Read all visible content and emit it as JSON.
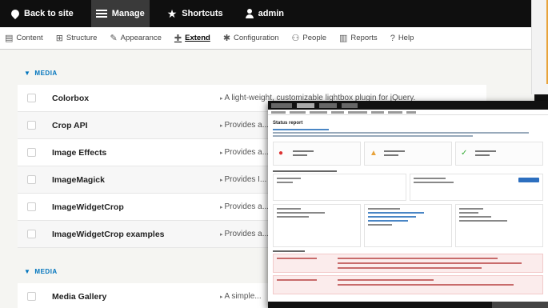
{
  "toolbar": {
    "back_label": "Back to site",
    "manage_label": "Manage",
    "shortcuts_label": "Shortcuts",
    "user_label": "admin"
  },
  "tray": {
    "items": [
      {
        "label": "Content",
        "glyph": "▤"
      },
      {
        "label": "Structure",
        "glyph": "⊞"
      },
      {
        "label": "Appearance",
        "glyph": "✎"
      },
      {
        "label": "Extend",
        "glyph": "✚"
      },
      {
        "label": "Configuration",
        "glyph": "✱"
      },
      {
        "label": "People",
        "glyph": "👤"
      },
      {
        "label": "Reports",
        "glyph": "▥"
      },
      {
        "label": "Help",
        "glyph": "?"
      }
    ],
    "active": "Extend"
  },
  "sections": [
    {
      "title": "MEDIA",
      "modules": [
        {
          "name": "Colorbox",
          "desc": "A light-weight, customizable lightbox plugin for jQuery."
        },
        {
          "name": "Crop API",
          "desc": "Provides a..."
        },
        {
          "name": "Image Effects",
          "desc": "Provides a..."
        },
        {
          "name": "ImageMagick",
          "desc": "Provides I..."
        },
        {
          "name": "ImageWidgetCrop",
          "desc": "Provides a..."
        },
        {
          "name": "ImageWidgetCrop examples",
          "desc": "Provides a..."
        }
      ]
    },
    {
      "title": "MEDIA",
      "modules": [
        {
          "name": "Media Gallery",
          "desc": "A simple..."
        }
      ]
    }
  ],
  "status_window": {
    "title": "Status report"
  },
  "colors": {
    "toolbar": "#0f0f0f",
    "accent_blue": "#0074bd",
    "accent_orange": "#e8a33b",
    "error": "#fbecec"
  }
}
